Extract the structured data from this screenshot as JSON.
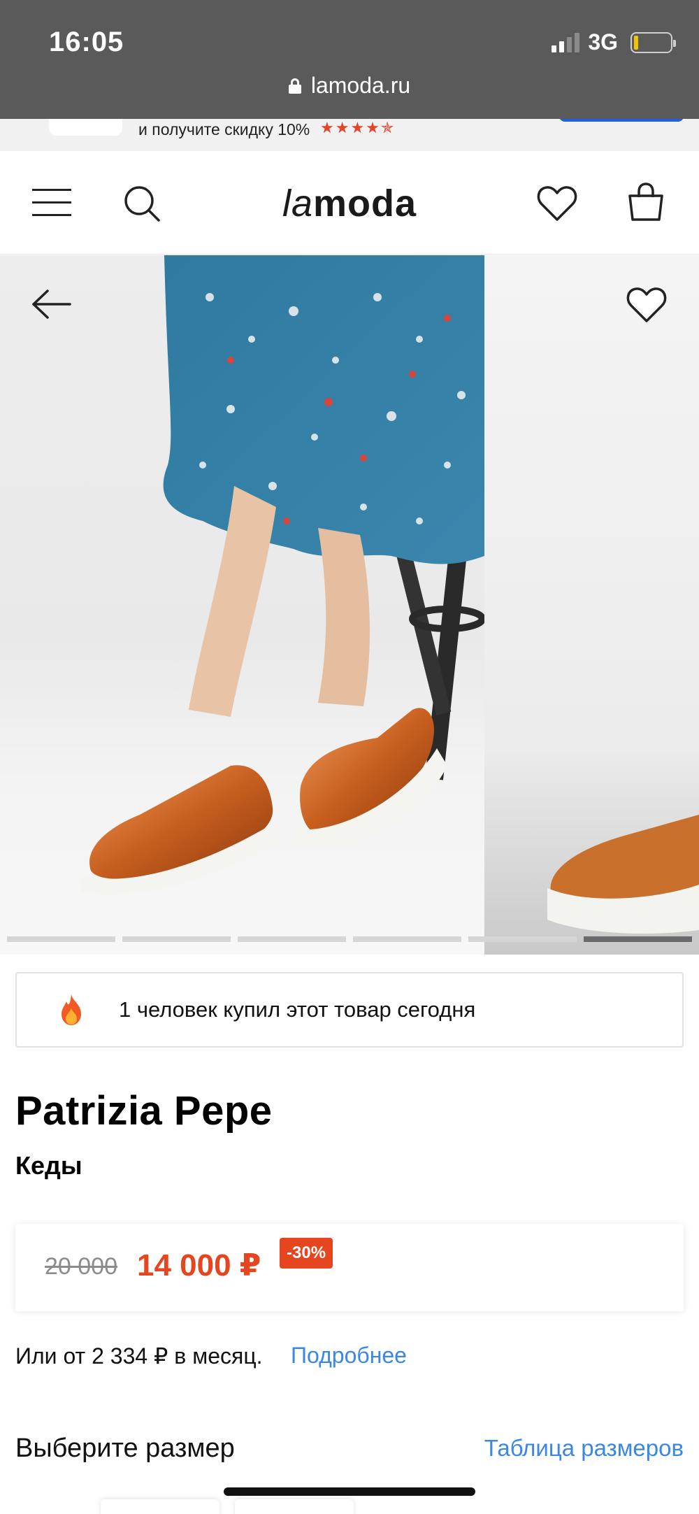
{
  "status_bar": {
    "time": "16:05",
    "network": "3G",
    "url": "lamoda.ru"
  },
  "promo": {
    "text": "и получите скидку 10%",
    "stars": "★★★★✯"
  },
  "header": {
    "logo_prefix": "la",
    "logo_suffix": "moda"
  },
  "gallery": {
    "slide_count": 6,
    "active_slide": 6
  },
  "notice": {
    "text": "1 человек купил этот товар сегодня"
  },
  "product": {
    "brand": "Patrizia Pepe",
    "type": "Кеды"
  },
  "price": {
    "old": "20 000",
    "current": "14 000 ₽",
    "discount": "-30%"
  },
  "installment": {
    "text": "Или от 2 334 ₽ в месяц.",
    "link": "Подробнее"
  },
  "size": {
    "title": "Выберите размер",
    "table_link": "Таблица размеров"
  },
  "colors": {
    "accent": "#e5451f",
    "link": "#3b87e8"
  }
}
